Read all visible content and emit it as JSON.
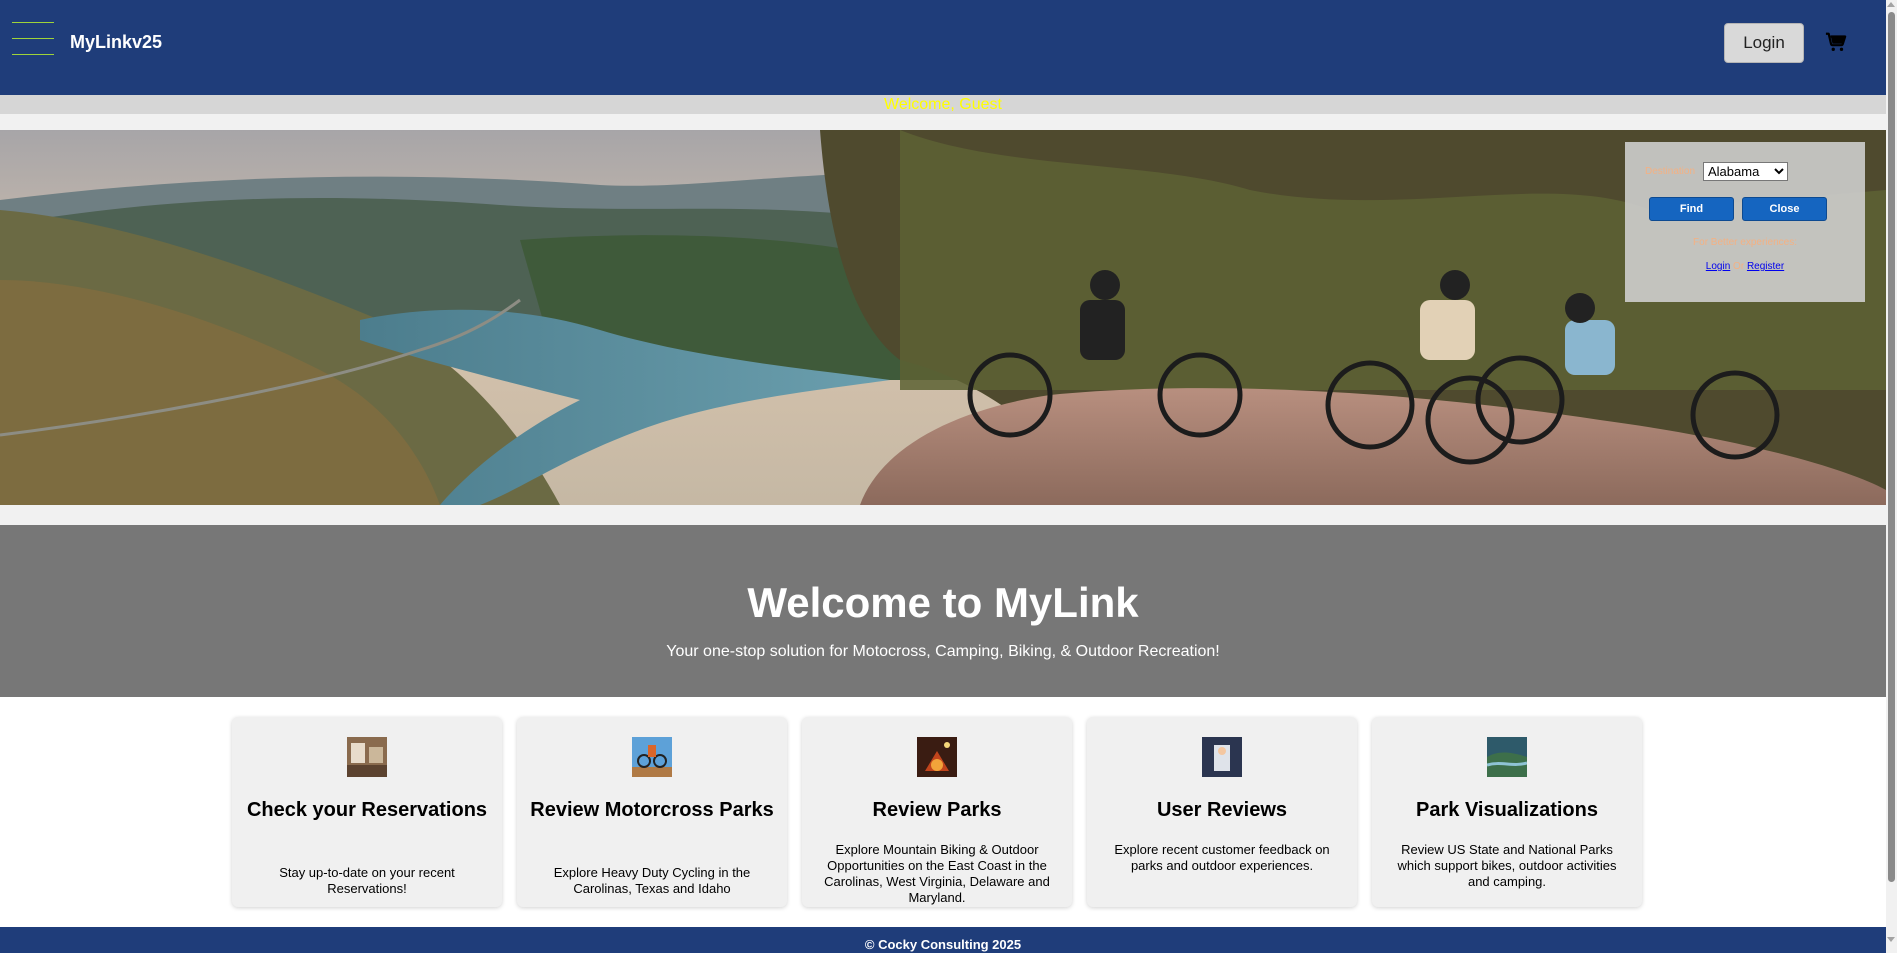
{
  "header": {
    "brand": "MyLinkv25",
    "login_label": "Login",
    "menu_icon": "hamburger-menu-icon",
    "cart_icon": "shopping-cart-icon"
  },
  "welcome_bar": {
    "text": "Welcome, Guest"
  },
  "destination": {
    "label": "Destination",
    "selected": "Alabama",
    "find_label": "Find",
    "close_label": "Close",
    "better_text": "For Better experiences:",
    "login_link": "Login",
    "or_text": "Or",
    "register_link": "Register"
  },
  "banner": {
    "title": "Welcome to MyLink",
    "subtitle": "Your one-stop solution for Motocross, Camping, Biking, & Outdoor Recreation!"
  },
  "cards": [
    {
      "title": "Check your Reservations",
      "desc": "Stay up-to-date on your recent Reservations!"
    },
    {
      "title": "Review Motorcross Parks",
      "desc": "Explore Heavy Duty Cycling in the Carolinas, Texas and Idaho"
    },
    {
      "title": "Review Parks",
      "desc": "Explore Mountain Biking & Outdoor Opportunities on the East Coast in the Carolinas, West Virginia, Delaware and Maryland."
    },
    {
      "title": "User Reviews",
      "desc": "Explore recent customer feedback on parks and outdoor experiences."
    },
    {
      "title": "Park Visualizations",
      "desc": "Review US State and National Parks which support bikes, outdoor activities and camping."
    }
  ],
  "footer": {
    "text": "© Cocky Consulting 2025"
  },
  "colors": {
    "header_bg": "#1f3d7a",
    "accent_green": "#9fd33a",
    "welcome_text": "#ffff00",
    "button_blue": "#1565c0",
    "banner_bg": "#777777"
  }
}
